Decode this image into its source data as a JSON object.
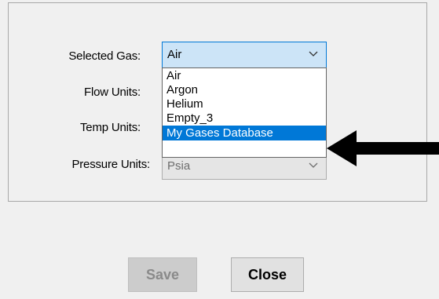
{
  "form": {
    "selected_gas_label": "Selected Gas:",
    "flow_units_label": "Flow Units:",
    "temp_units_label": "Temp Units:",
    "pressure_units_label": "Pressure Units:",
    "selected_gas_value": "Air",
    "pressure_units_value": "Psia"
  },
  "gas_dropdown": {
    "options": [
      "Air",
      "Argon",
      "Helium",
      "Empty_3",
      "My Gases Database"
    ],
    "highlighted": "My Gases Database"
  },
  "buttons": {
    "save_label": "Save",
    "close_label": "Close"
  },
  "icons": {
    "combo_arrow": "chevron-down-icon",
    "callout": "arrow-left-icon"
  },
  "colors": {
    "highlight": "#0078d7",
    "combo_open_bg": "#cce4f7"
  }
}
